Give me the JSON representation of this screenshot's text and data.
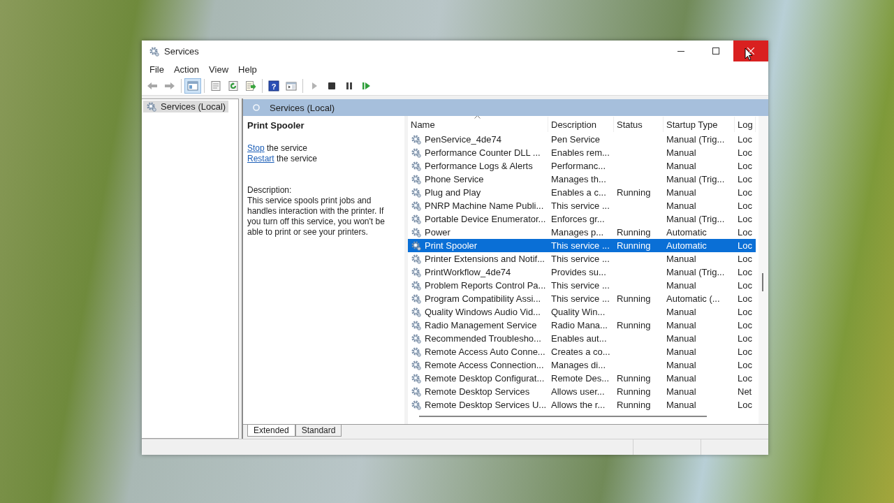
{
  "window": {
    "title": "Services"
  },
  "menu": [
    "File",
    "Action",
    "View",
    "Help"
  ],
  "toolbar": [
    {
      "kind": "back",
      "selected": false,
      "disabled": true
    },
    {
      "kind": "forward",
      "selected": false,
      "disabled": true
    },
    {
      "kind": "sep"
    },
    {
      "kind": "tree",
      "selected": true,
      "disabled": false
    },
    {
      "kind": "sep"
    },
    {
      "kind": "properties",
      "selected": false,
      "disabled": false
    },
    {
      "kind": "refresh",
      "selected": false,
      "disabled": false
    },
    {
      "kind": "export",
      "selected": false,
      "disabled": false
    },
    {
      "kind": "sep"
    },
    {
      "kind": "help",
      "glyph": "?",
      "selected": false,
      "disabled": false
    },
    {
      "kind": "actionpane",
      "selected": false,
      "disabled": false
    },
    {
      "kind": "sep"
    },
    {
      "kind": "play",
      "selected": false,
      "disabled": true
    },
    {
      "kind": "stop",
      "selected": false,
      "disabled": false
    },
    {
      "kind": "pause",
      "selected": false,
      "disabled": false
    },
    {
      "kind": "resume",
      "selected": false,
      "disabled": false
    }
  ],
  "tree": {
    "items": [
      {
        "label": "Services (Local)",
        "selected": true
      }
    ]
  },
  "pane_header": "Services (Local)",
  "details": {
    "title": "Print Spooler",
    "actions": [
      {
        "link": "Stop",
        "text": "the service"
      },
      {
        "link": "Restart",
        "text": "the service"
      }
    ],
    "description_label": "Description:",
    "description": "This service spools print jobs and handles interaction with the printer. If you turn off this service, you won't be able to print or see your printers."
  },
  "table": {
    "columns": [
      "Name",
      "Description",
      "Status",
      "Startup Type",
      "Log"
    ],
    "rows": [
      {
        "name": "PenService_4de74",
        "description": "Pen Service",
        "status": "",
        "startup_type": "Manual (Trig...",
        "log_on_as": "Loc",
        "selected": false
      },
      {
        "name": "Performance Counter DLL ...",
        "description": "Enables rem...",
        "status": "",
        "startup_type": "Manual",
        "log_on_as": "Loc",
        "selected": false
      },
      {
        "name": "Performance Logs & Alerts",
        "description": "Performanc...",
        "status": "",
        "startup_type": "Manual",
        "log_on_as": "Loc",
        "selected": false
      },
      {
        "name": "Phone Service",
        "description": "Manages th...",
        "status": "",
        "startup_type": "Manual (Trig...",
        "log_on_as": "Loc",
        "selected": false
      },
      {
        "name": "Plug and Play",
        "description": "Enables a c...",
        "status": "Running",
        "startup_type": "Manual",
        "log_on_as": "Loc",
        "selected": false
      },
      {
        "name": "PNRP Machine Name Publi...",
        "description": "This service ...",
        "status": "",
        "startup_type": "Manual",
        "log_on_as": "Loc",
        "selected": false
      },
      {
        "name": "Portable Device Enumerator...",
        "description": "Enforces gr...",
        "status": "",
        "startup_type": "Manual (Trig...",
        "log_on_as": "Loc",
        "selected": false
      },
      {
        "name": "Power",
        "description": "Manages p...",
        "status": "Running",
        "startup_type": "Automatic",
        "log_on_as": "Loc",
        "selected": false
      },
      {
        "name": "Print Spooler",
        "description": "This service ...",
        "status": "Running",
        "startup_type": "Automatic",
        "log_on_as": "Loc",
        "selected": true
      },
      {
        "name": "Printer Extensions and Notif...",
        "description": "This service ...",
        "status": "",
        "startup_type": "Manual",
        "log_on_as": "Loc",
        "selected": false
      },
      {
        "name": "PrintWorkflow_4de74",
        "description": "Provides su...",
        "status": "",
        "startup_type": "Manual (Trig...",
        "log_on_as": "Loc",
        "selected": false
      },
      {
        "name": "Problem Reports Control Pa...",
        "description": "This service ...",
        "status": "",
        "startup_type": "Manual",
        "log_on_as": "Loc",
        "selected": false
      },
      {
        "name": "Program Compatibility Assi...",
        "description": "This service ...",
        "status": "Running",
        "startup_type": "Automatic (...",
        "log_on_as": "Loc",
        "selected": false
      },
      {
        "name": "Quality Windows Audio Vid...",
        "description": "Quality Win...",
        "status": "",
        "startup_type": "Manual",
        "log_on_as": "Loc",
        "selected": false
      },
      {
        "name": "Radio Management Service",
        "description": "Radio Mana...",
        "status": "Running",
        "startup_type": "Manual",
        "log_on_as": "Loc",
        "selected": false
      },
      {
        "name": "Recommended Troublesho...",
        "description": "Enables aut...",
        "status": "",
        "startup_type": "Manual",
        "log_on_as": "Loc",
        "selected": false
      },
      {
        "name": "Remote Access Auto Conne...",
        "description": "Creates a co...",
        "status": "",
        "startup_type": "Manual",
        "log_on_as": "Loc",
        "selected": false
      },
      {
        "name": "Remote Access Connection...",
        "description": "Manages di...",
        "status": "",
        "startup_type": "Manual",
        "log_on_as": "Loc",
        "selected": false
      },
      {
        "name": "Remote Desktop Configurat...",
        "description": "Remote Des...",
        "status": "Running",
        "startup_type": "Manual",
        "log_on_as": "Loc",
        "selected": false
      },
      {
        "name": "Remote Desktop Services",
        "description": "Allows user...",
        "status": "Running",
        "startup_type": "Manual",
        "log_on_as": "Net",
        "selected": false
      },
      {
        "name": "Remote Desktop Services U...",
        "description": "Allows the r...",
        "status": "Running",
        "startup_type": "Manual",
        "log_on_as": "Loc",
        "selected": false
      }
    ]
  },
  "tabs": [
    {
      "label": "Extended",
      "selected": true
    },
    {
      "label": "Standard",
      "selected": false
    }
  ]
}
